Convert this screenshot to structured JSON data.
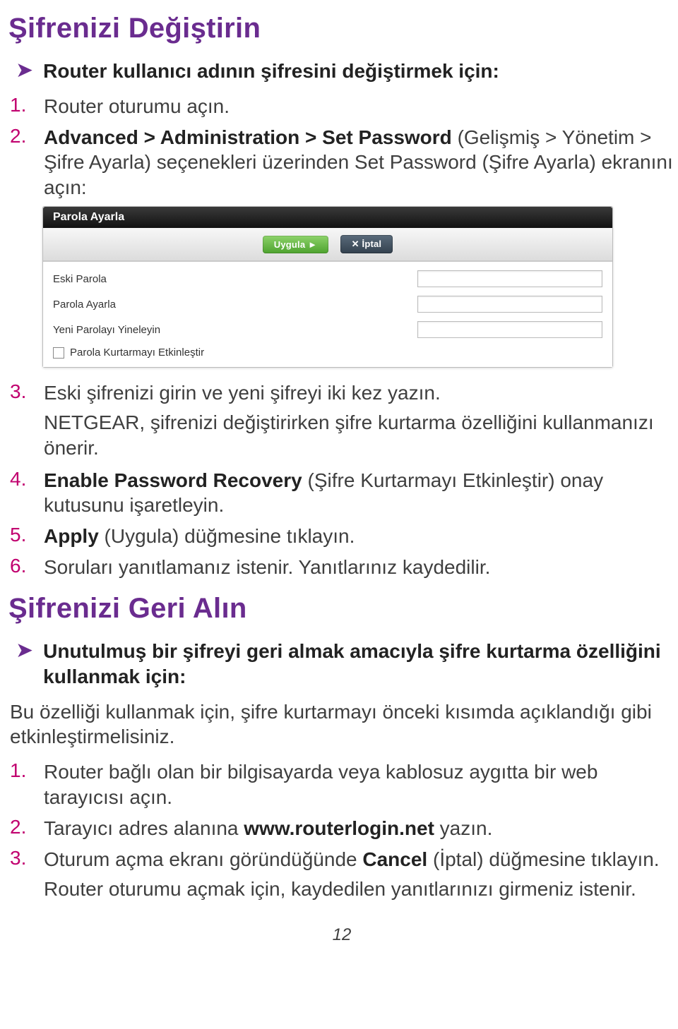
{
  "heading1": "Şifrenizi Değiştirin",
  "sec1": {
    "lead": "Router kullanıcı adının şifresini değiştirmek için:",
    "steps": {
      "s1": {
        "num": "1.",
        "text": "Router oturumu açın."
      },
      "s2": {
        "num": "2.",
        "before": "",
        "bold": "Advanced > Administration > Set Password",
        "after": " (Gelişmiş > Yönetim > Şifre Ayarla) seçenekleri üzerinden Set Password (Şifre Ayarla) ekranını açın:"
      },
      "s3": {
        "num": "3.",
        "text": "Eski şifrenizi girin ve yeni şifreyi iki kez yazın."
      },
      "s3_note": "NETGEAR, şifrenizi değiştirirken şifre kurtarma özelliğini kullanmanızı önerir.",
      "s4": {
        "num": "4.",
        "bold": "Enable Password Recovery",
        "after": " (Şifre Kurtarmayı Etkinleştir) onay kutusunu işaretleyin."
      },
      "s5": {
        "num": "5.",
        "bold": "Apply",
        "after": " (Uygula) düğmesine tıklayın."
      },
      "s6": {
        "num": "6.",
        "text": "Soruları yanıtlamanız istenir. Yanıtlarınız kaydedilir."
      }
    }
  },
  "router": {
    "title": "Parola Ayarla",
    "apply": "Uygula ►",
    "cancel": "✕ İptal",
    "fields": {
      "old": "Eski Parola",
      "new": "Parola Ayarla",
      "repeat": "Yeni Parolayı Yineleyin",
      "recovery": "Parola Kurtarmayı Etkinleştir"
    }
  },
  "heading2": "Şifrenizi Geri Alın",
  "sec2": {
    "lead": "Unutulmuş bir şifreyi geri almak amacıyla şifre kurtarma özelliğini kullanmak için:",
    "intro": "Bu özelliği kullanmak için, şifre kurtarmayı önceki kısımda açıklandığı gibi etkinleştirmelisiniz.",
    "steps": {
      "s1": {
        "num": "1.",
        "text": "Router bağlı olan bir bilgisayarda veya kablosuz aygıtta bir web tarayıcısı açın."
      },
      "s2": {
        "num": "2.",
        "before": "Tarayıcı adres alanına ",
        "bold": "www.routerlogin.net",
        "after": " yazın."
      },
      "s3": {
        "num": "3.",
        "before": "Oturum açma ekranı göründüğünde ",
        "bold": "Cancel",
        "after": " (İptal) düğmesine tıklayın."
      },
      "s3_note": "Router oturumu açmak için, kaydedilen yanıtlarınızı girmeniz istenir."
    }
  },
  "pagenum": "12"
}
